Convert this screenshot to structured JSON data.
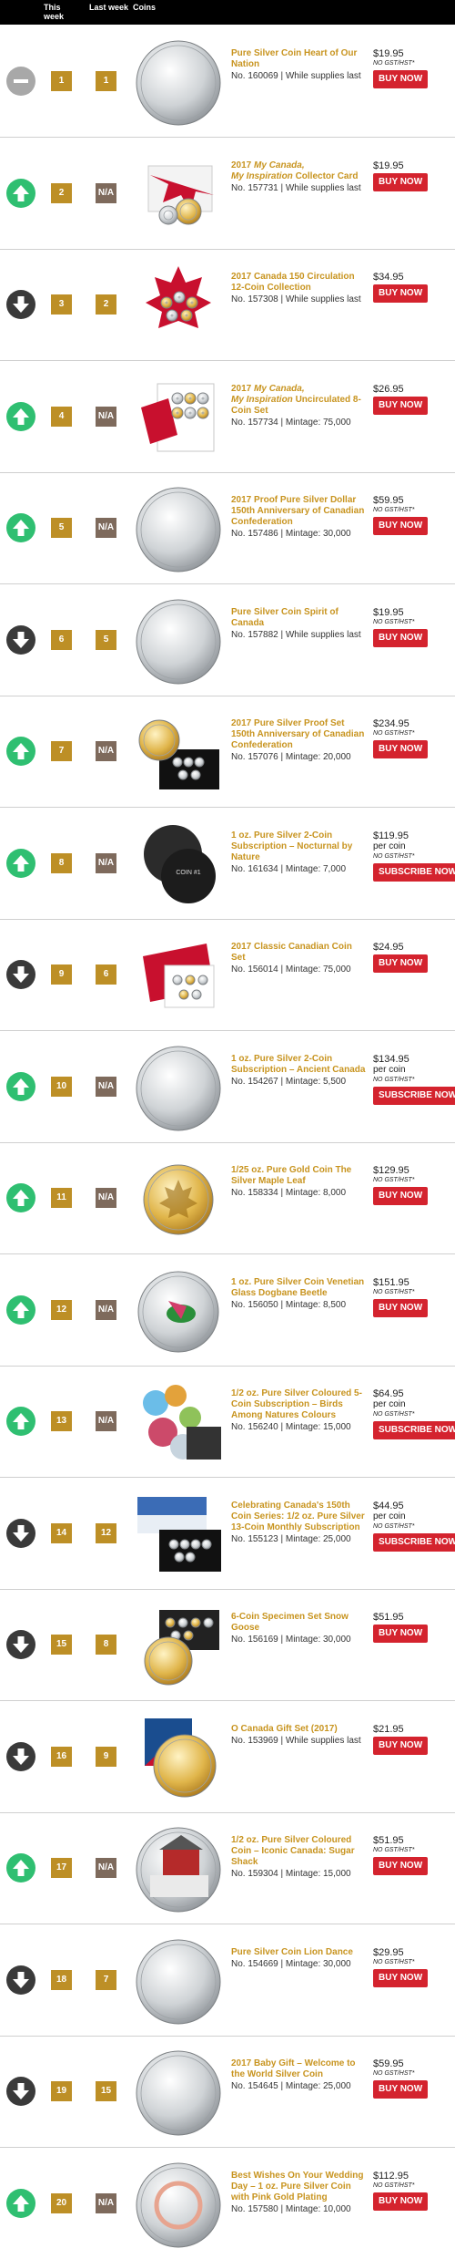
{
  "header": {
    "this_week": "This week",
    "last_week": "Last week",
    "coins": "Coins"
  },
  "colors": {
    "up": "#2fbf71",
    "down": "#3a3a3a",
    "same": "#a8a8a8",
    "gold": "#bd8f26",
    "na": "#7e6a5c",
    "buy": "#d4232e"
  },
  "rows": [
    {
      "move": "same",
      "rank": "1",
      "prev": "1",
      "title": "Pure Silver Coin Heart of Our Nation",
      "meta": "No. 160069 | While supplies last",
      "price": "$19.95",
      "per": "",
      "gst": "NO GST/HST*",
      "btn": "BUY NOW",
      "thumb": "silver-150-coin"
    },
    {
      "move": "up",
      "rank": "2",
      "prev": "N/A",
      "title": "2017 My Canada, My Inspiration Collector Card",
      "meta": "No. 157731 | While supplies last",
      "price": "$19.95",
      "per": "",
      "gst": "",
      "btn": "BUY NOW",
      "thumb": "collector-card"
    },
    {
      "move": "down",
      "rank": "3",
      "prev": "2",
      "title": "2017 Canada 150 Circulation 12-Coin Collection",
      "meta": "No. 157308 | While supplies last",
      "price": "$34.95",
      "per": "",
      "gst": "",
      "btn": "BUY NOW",
      "thumb": "maple-leaf-collection"
    },
    {
      "move": "up",
      "rank": "4",
      "prev": "N/A",
      "title": "2017 My Canada, My Inspiration Uncirculated 8-Coin Set",
      "meta": "No. 157734 | Mintage: 75,000",
      "price": "$26.95",
      "per": "",
      "gst": "",
      "btn": "BUY NOW",
      "thumb": "uncirculated-set"
    },
    {
      "move": "up",
      "rank": "5",
      "prev": "N/A",
      "title": "2017 Proof Pure Silver Dollar 150th Anniversary of Canadian Confederation",
      "meta": "No. 157486 | Mintage: 30,000",
      "price": "$59.95",
      "per": "",
      "gst": "NO GST/HST*",
      "btn": "BUY NOW",
      "thumb": "silver-tree-coin"
    },
    {
      "move": "down",
      "rank": "6",
      "prev": "5",
      "title": "Pure Silver Coin Spirit of Canada",
      "meta": "No. 157882 | While supplies last",
      "price": "$19.95",
      "per": "",
      "gst": "NO GST/HST*",
      "btn": "BUY NOW",
      "thumb": "silver-spirit-coin"
    },
    {
      "move": "up",
      "rank": "7",
      "prev": "N/A",
      "title": "2017 Pure Silver Proof Set 150th Anniversary of Canadian Confederation",
      "meta": "No. 157076 | Mintage: 20,000",
      "price": "$234.95",
      "per": "",
      "gst": "NO GST/HST*",
      "btn": "BUY NOW",
      "thumb": "proof-set"
    },
    {
      "move": "up",
      "rank": "8",
      "prev": "N/A",
      "title": "1 oz. Pure Silver 2-Coin Subscription – Nocturnal by Nature",
      "meta": "No. 161634 | Mintage: 7,000",
      "price": "$119.95",
      "per": "per coin",
      "gst": "NO GST/HST*",
      "btn": "SUBSCRIBE NOW",
      "thumb": "owl-coin"
    },
    {
      "move": "down",
      "rank": "9",
      "prev": "6",
      "title": "2017 Classic Canadian Coin Set",
      "meta": "No. 156014 | Mintage: 75,000",
      "price": "$24.95",
      "per": "",
      "gst": "",
      "btn": "BUY NOW",
      "thumb": "classic-set"
    },
    {
      "move": "up",
      "rank": "10",
      "prev": "N/A",
      "title": "1 oz. Pure Silver 2-Coin Subscription – Ancient Canada",
      "meta": "No. 154267 | Mintage: 5,500",
      "price": "$134.95",
      "per": "per coin",
      "gst": "NO GST/HST*",
      "btn": "SUBSCRIBE NOW",
      "thumb": "ancient-coin"
    },
    {
      "move": "up",
      "rank": "11",
      "prev": "N/A",
      "title": "1/25 oz. Pure Gold Coin The Silver Maple Leaf",
      "meta": "No. 158334 | Mintage: 8,000",
      "price": "$129.95",
      "per": "",
      "gst": "NO GST/HST*",
      "btn": "BUY NOW",
      "thumb": "gold-maple-coin"
    },
    {
      "move": "up",
      "rank": "12",
      "prev": "N/A",
      "title": "1 oz. Pure Silver Coin Venetian Glass Dogbane Beetle",
      "meta": "No. 156050 | Mintage: 8,500",
      "price": "$151.95",
      "per": "",
      "gst": "NO GST/HST*",
      "btn": "BUY NOW",
      "thumb": "beetle-coin"
    },
    {
      "move": "up",
      "rank": "13",
      "prev": "N/A",
      "title": "1/2 oz. Pure Silver Coloured 5-Coin Subscription – Birds Among Natures Colours",
      "meta": "No. 156240 | Mintage: 15,000",
      "price": "$64.95",
      "per": "per coin",
      "gst": "NO GST/HST*",
      "btn": "SUBSCRIBE NOW",
      "thumb": "birds-coins"
    },
    {
      "move": "down",
      "rank": "14",
      "prev": "12",
      "title": "Celebrating Canada's 150th Coin Series: 1/2 oz. Pure Silver 13-Coin Monthly Subscription",
      "meta": "No. 155123 | Mintage: 25,000",
      "price": "$44.95",
      "per": "per coin",
      "gst": "NO GST/HST*",
      "btn": "SUBSCRIBE NOW",
      "thumb": "canada-150-series"
    },
    {
      "move": "down",
      "rank": "15",
      "prev": "8",
      "title": "6-Coin Specimen Set Snow Goose",
      "meta": "No. 156169 | Mintage: 30,000",
      "price": "$51.95",
      "per": "",
      "gst": "",
      "btn": "BUY NOW",
      "thumb": "snow-goose-set"
    },
    {
      "move": "down",
      "rank": "16",
      "prev": "9",
      "title": "O Canada Gift Set (2017)",
      "meta": "No. 153969 | While supplies last",
      "price": "$21.95",
      "per": "",
      "gst": "",
      "btn": "BUY NOW",
      "thumb": "o-canada-gift-set"
    },
    {
      "move": "up",
      "rank": "17",
      "prev": "N/A",
      "title": "1/2 oz. Pure Silver Coloured Coin – Iconic Canada: Sugar Shack",
      "meta": "No. 159304 | Mintage: 15,000",
      "price": "$51.95",
      "per": "",
      "gst": "NO GST/HST*",
      "btn": "BUY NOW",
      "thumb": "sugar-shack-coin"
    },
    {
      "move": "down",
      "rank": "18",
      "prev": "7",
      "title": "Pure Silver Coin Lion Dance",
      "meta": "No. 154669 | Mintage: 30,000",
      "price": "$29.95",
      "per": "",
      "gst": "NO GST/HST*",
      "btn": "BUY NOW",
      "thumb": "lion-dance-coin"
    },
    {
      "move": "down",
      "rank": "19",
      "prev": "15",
      "title": "2017 Baby Gift – Welcome to the World Silver Coin",
      "meta": "No. 154645 | Mintage: 25,000",
      "price": "$59.95",
      "per": "",
      "gst": "NO GST/HST*",
      "btn": "BUY NOW",
      "thumb": "baby-gift-coin"
    },
    {
      "move": "up",
      "rank": "20",
      "prev": "N/A",
      "title": "Best Wishes On Your Wedding Day – 1 oz. Pure Silver Coin with Pink Gold Plating",
      "meta": "No. 157580 | Mintage: 10,000",
      "price": "$112.95",
      "per": "",
      "gst": "NO GST/HST*",
      "btn": "BUY NOW",
      "thumb": "wedding-coin"
    }
  ]
}
